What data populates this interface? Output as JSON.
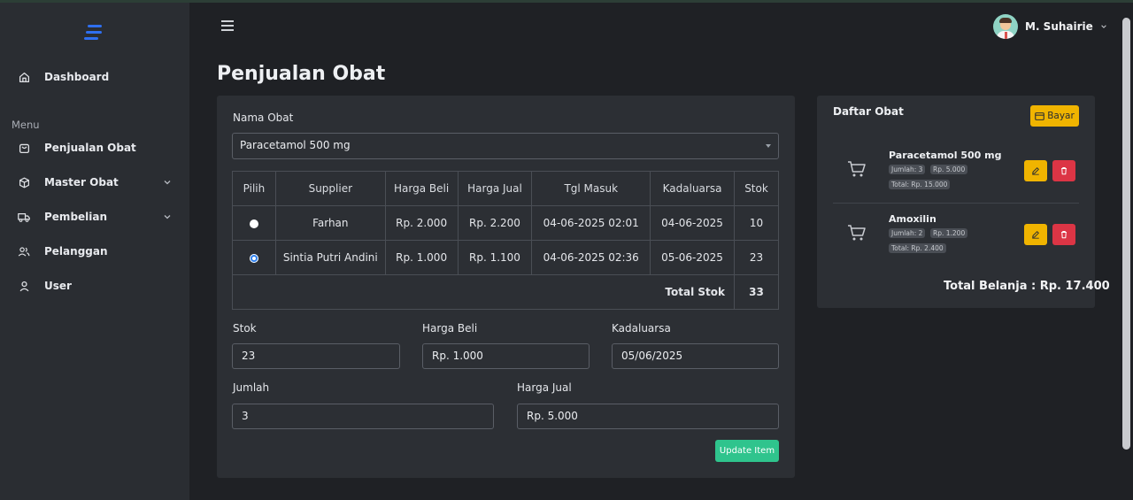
{
  "colors": {
    "accent": "#2f6ff0",
    "success": "#2fc48d",
    "warning": "#f0b400",
    "danger": "#dc3545",
    "sidebar_bg": "#2a2d32",
    "page_bg": "#1f2125",
    "card_bg": "#2c2f34"
  },
  "sidebar": {
    "logo_icon": "logo-icon",
    "menu_heading": "Menu",
    "items": [
      {
        "label": "Dashboard",
        "icon": "home-icon"
      },
      {
        "label": "Penjualan Obat",
        "icon": "bag-icon"
      },
      {
        "label": "Master Obat",
        "icon": "box-icon",
        "expandable": true
      },
      {
        "label": "Pembelian",
        "icon": "truck-icon",
        "expandable": true
      },
      {
        "label": "Pelanggan",
        "icon": "users-icon"
      },
      {
        "label": "User",
        "icon": "user-icon"
      }
    ]
  },
  "header": {
    "user_name": "M. Suhairie"
  },
  "page": {
    "title": "Penjualan Obat"
  },
  "form": {
    "nama_obat_label": "Nama Obat",
    "nama_obat_value": "Paracetamol 500 mg",
    "table": {
      "headers": [
        "Pilih",
        "Supplier",
        "Harga Beli",
        "Harga Jual",
        "Tgl Masuk",
        "Kadaluarsa",
        "Stok"
      ],
      "rows": [
        {
          "selected": false,
          "supplier": "Farhan",
          "harga_beli": "Rp. 2.000",
          "harga_jual": "Rp. 2.200",
          "tgl_masuk": "04-06-2025 02:01",
          "kadaluarsa": "04-06-2025",
          "stok": "10"
        },
        {
          "selected": true,
          "supplier": "Sintia Putri Andini",
          "harga_beli": "Rp. 1.000",
          "harga_jual": "Rp. 1.100",
          "tgl_masuk": "04-06-2025 02:36",
          "kadaluarsa": "05-06-2025",
          "stok": "23"
        }
      ],
      "total_label": "Total Stok",
      "total_value": "33"
    },
    "stok_label": "Stok",
    "stok_value": "23",
    "harga_beli_label": "Harga Beli",
    "harga_beli_value": "Rp. 1.000",
    "kadaluarsa_label": "Kadaluarsa",
    "kadaluarsa_value": "05/06/2025",
    "jumlah_label": "Jumlah",
    "jumlah_value": "3",
    "harga_jual_label": "Harga Jual",
    "harga_jual_value": "Rp. 5.000",
    "update_button": "Update Item"
  },
  "cart": {
    "title": "Daftar Obat",
    "pay_button": "Bayar",
    "items": [
      {
        "name": "Paracetamol 500 mg",
        "qty": "Jumlah: 3",
        "price": "Rp. 5.000",
        "total": "Total: Rp. 15.000"
      },
      {
        "name": "Amoxilin",
        "qty": "Jumlah: 2",
        "price": "Rp. 1.200",
        "total": "Total: Rp. 2.400"
      }
    ],
    "grand_total": "Total Belanja : Rp. 17.400"
  }
}
